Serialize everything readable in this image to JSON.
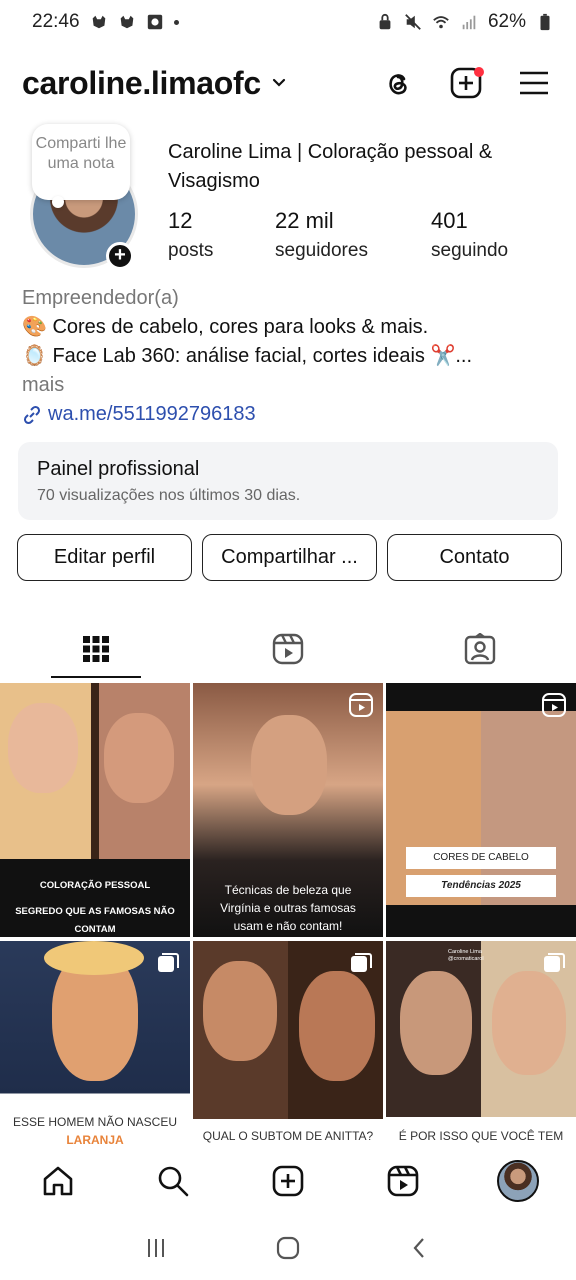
{
  "status_bar": {
    "time": "22:46",
    "battery": "62%"
  },
  "header": {
    "username": "caroline.limaofc"
  },
  "profile": {
    "note": "Comparti lhe uma nota",
    "display_name": "Caroline Lima | Coloração pessoal & Visagismo",
    "stats": [
      {
        "value": "12",
        "label": "posts"
      },
      {
        "value": "22 mil",
        "label": "seguidores"
      },
      {
        "value": "401",
        "label": "seguindo"
      }
    ],
    "category": "Empreendedor(a)",
    "bio_line1": "🎨 Cores de cabelo, cores para looks & mais.",
    "bio_line2": "🪞 Face Lab 360:  análise facial, cortes ideais ✂️...",
    "more": "mais",
    "link": "wa.me/5511992796183"
  },
  "dashboard": {
    "title": "Painel profissional",
    "subtitle": "70 visualizações nos últimos 30 dias."
  },
  "buttons": {
    "edit": "Editar perfil",
    "share": "Compartilhar ...",
    "contact": "Contato"
  },
  "grid": [
    {
      "caption1": "COLORAÇÃO PESSOAL",
      "caption2": "SEGREDO QUE AS FAMOSAS NÃO CONTAM",
      "badge": ""
    },
    {
      "caption1": "Técnicas de beleza que",
      "caption2": "Virgínia e outras famosas",
      "caption3": "usam e não contam!",
      "badge": "reel-icon"
    },
    {
      "caption1": "CORES DE CABELO",
      "caption2": "Tendências 2025",
      "badge": "reel-icon"
    },
    {
      "caption1": "ESSE HOMEM NÃO NASCEU",
      "caption2": "LARANJA",
      "badge": "carousel-icon"
    },
    {
      "caption1": "QUAL O SUBTOM DE ANITTA?",
      "badge": "carousel-icon"
    },
    {
      "caption1": "É POR ISSO QUE VOCÊ TEM",
      "caption2": "Caroline Lima",
      "caption3": "@cromaticarol",
      "badge": "carousel-icon"
    }
  ],
  "colors": {
    "link": "#2d4fae",
    "notification": "#ff3040",
    "accent_orange": "#e8833a"
  }
}
